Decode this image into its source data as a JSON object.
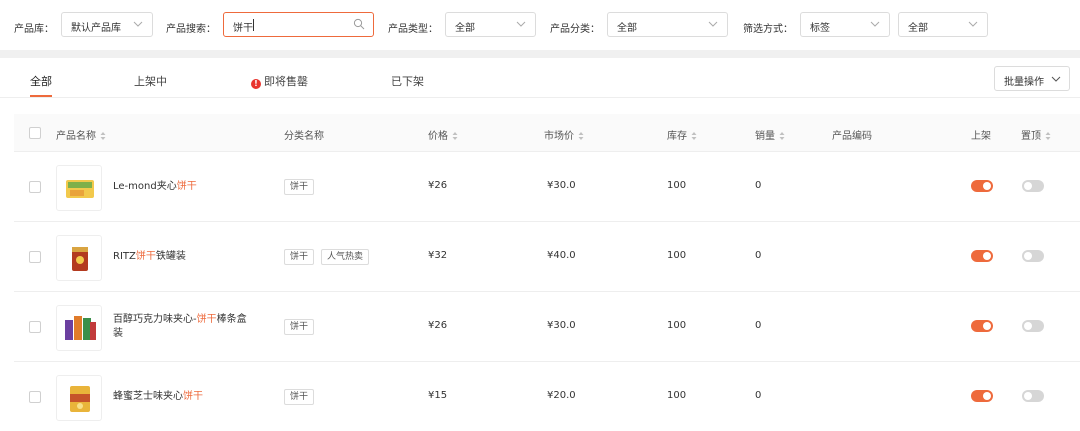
{
  "filters": {
    "library_label": "产品库：",
    "library_value": "默认产品库",
    "search_label": "产品搜索：",
    "search_value": "饼干",
    "type_label": "产品类型：",
    "type_value": "全部",
    "category_label": "产品分类：",
    "category_value": "全部",
    "filter_mode_label": "筛选方式：",
    "filter_mode_value": "标签",
    "filter_value": "全部"
  },
  "tabs": [
    {
      "label": "全部",
      "active": true
    },
    {
      "label": "上架中",
      "active": false
    },
    {
      "label": "即将售罄",
      "active": false,
      "icon": "warning-icon"
    },
    {
      "label": "已下架",
      "active": false
    }
  ],
  "batch_button": "批量操作",
  "columns": {
    "name": "产品名称",
    "category": "分类名称",
    "price": "价格",
    "market_price": "市场价",
    "stock": "库存",
    "sales": "销量",
    "code": "产品编码",
    "listed": "上架",
    "pinned": "置顶"
  },
  "rows": [
    {
      "name_pre": "Le-mond夹心",
      "name_hl": "饼干",
      "name_post": "",
      "tags": [
        "饼干"
      ],
      "price": "¥26",
      "market_price": "¥30.0",
      "stock": "100",
      "sales": "0",
      "code": "",
      "listed": true,
      "pinned": false
    },
    {
      "name_pre": "RITZ",
      "name_hl": "饼干",
      "name_post": "铁罐装",
      "tags": [
        "饼干",
        "人气热卖"
      ],
      "price": "¥32",
      "market_price": "¥40.0",
      "stock": "100",
      "sales": "0",
      "code": "",
      "listed": true,
      "pinned": false
    },
    {
      "name_pre": "百醇巧克力味夹心-",
      "name_hl": "饼干",
      "name_post": "棒条盒装",
      "tags": [
        "饼干"
      ],
      "price": "¥26",
      "market_price": "¥30.0",
      "stock": "100",
      "sales": "0",
      "code": "",
      "listed": true,
      "pinned": false
    },
    {
      "name_pre": "蜂蜜芝士味夹心",
      "name_hl": "饼干",
      "name_post": "",
      "tags": [
        "饼干"
      ],
      "price": "¥15",
      "market_price": "¥20.0",
      "stock": "100",
      "sales": "0",
      "code": "",
      "listed": true,
      "pinned": false
    }
  ],
  "colors": {
    "accent": "#ee6a3c",
    "warning": "#e8352e"
  }
}
